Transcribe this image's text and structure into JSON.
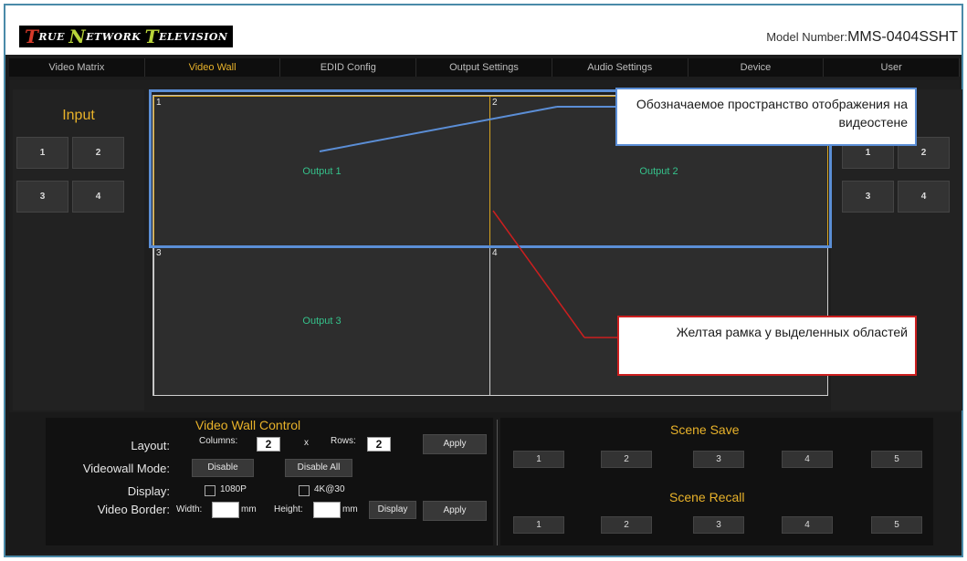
{
  "header": {
    "logo_text": "True Network Television",
    "model_label": "Model Number:",
    "model_value": "MMS-0404SSHT"
  },
  "nav": {
    "tabs": [
      "Video Matrix",
      "Video Wall",
      "EDID Config",
      "Output Settings",
      "Audio Settings",
      "Device",
      "User"
    ],
    "active": "Video Wall"
  },
  "inputs": {
    "title": "Input",
    "left_buttons": [
      "1",
      "2",
      "3",
      "4"
    ],
    "right_buttons": [
      "1",
      "2",
      "3",
      "4"
    ]
  },
  "wall": {
    "cells": [
      {
        "num": "1",
        "label": "Output 1",
        "selected": true
      },
      {
        "num": "2",
        "label": "Output 2",
        "selected": true
      },
      {
        "num": "3",
        "label": "Output 3",
        "selected": false
      },
      {
        "num": "4",
        "label": "",
        "selected": false
      }
    ]
  },
  "annotations": {
    "blue_note": "Обозначаемое пространство отображения на видеостене",
    "red_note": "Желтая рамка у выделенных областей",
    "blue_color": "#5b8ed6",
    "red_color": "#cc1f1f"
  },
  "control": {
    "title": "Video Wall Control",
    "layout_label": "Layout:",
    "columns_label": "Columns:",
    "columns_value": "2",
    "x_label": "x",
    "rows_label": "Rows:",
    "rows_value": "2",
    "apply_label": "Apply",
    "mode_label": "Videowall Mode:",
    "disable_label": "Disable",
    "disable_all_label": "Disable All",
    "display_label": "Display:",
    "opt_1080p": "1080P",
    "opt_4k": "4K@30",
    "border_label": "Video Border:",
    "width_label": "Width:",
    "height_label": "Height:",
    "mm_label": "mm",
    "display_btn": "Display",
    "apply2_label": "Apply"
  },
  "scene": {
    "save_title": "Scene Save",
    "recall_title": "Scene Recall",
    "save_buttons": [
      "1",
      "2",
      "3",
      "4",
      "5"
    ],
    "recall_buttons": [
      "1",
      "2",
      "3",
      "4",
      "5"
    ]
  },
  "colors": {
    "accent": "#e8b22a",
    "output_text": "#35c28b",
    "background": "#1c1c1c"
  }
}
